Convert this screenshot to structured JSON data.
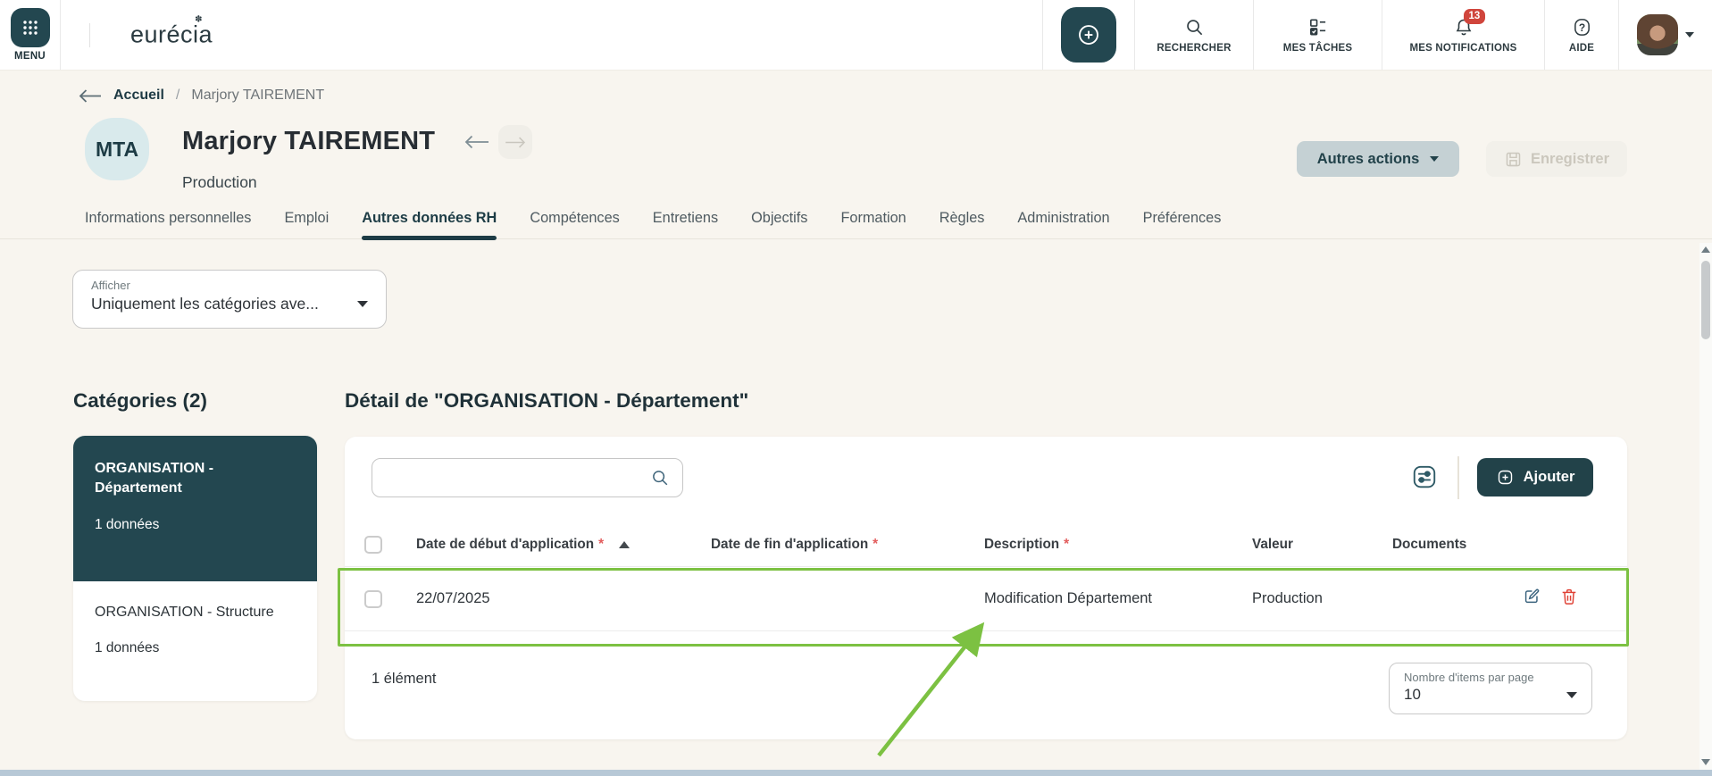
{
  "topbar": {
    "menu_label": "MENU",
    "logo_text": "eurécia",
    "nav": [
      {
        "label": "RECHERCHER"
      },
      {
        "label": "MES TÂCHES"
      },
      {
        "label": "MES NOTIFICATIONS",
        "badge": "13"
      },
      {
        "label": "AIDE"
      }
    ]
  },
  "breadcrumb": {
    "home": "Accueil",
    "separator": "/",
    "current": "Marjory TAIREMENT"
  },
  "profile": {
    "initials": "MTA",
    "name": "Marjory TAIREMENT",
    "department": "Production",
    "other_actions_label": "Autres actions",
    "save_label": "Enregistrer"
  },
  "tabs": [
    {
      "label": "Informations personnelles"
    },
    {
      "label": "Emploi"
    },
    {
      "label": "Autres données RH",
      "active": true
    },
    {
      "label": "Compétences"
    },
    {
      "label": "Entretiens"
    },
    {
      "label": "Objectifs"
    },
    {
      "label": "Formation"
    },
    {
      "label": "Règles"
    },
    {
      "label": "Administration"
    },
    {
      "label": "Préférences"
    }
  ],
  "display_filter": {
    "label": "Afficher",
    "value": "Uniquement les catégories ave..."
  },
  "categories": {
    "title": "Catégories (2)",
    "items": [
      {
        "name": "ORGANISATION - Département",
        "count": "1 données",
        "selected": true
      },
      {
        "name": "ORGANISATION - Structure",
        "count": "1 données",
        "selected": false
      }
    ]
  },
  "detail": {
    "title": "Détail de \"ORGANISATION - Département\"",
    "add_label": "Ajouter",
    "required_mark": "*",
    "columns": [
      {
        "label": "Date de début d'application",
        "required": true,
        "sorted": "asc"
      },
      {
        "label": "Date de fin d'application",
        "required": true
      },
      {
        "label": "Description",
        "required": true
      },
      {
        "label": "Valeur"
      },
      {
        "label": "Documents"
      }
    ],
    "rows": [
      {
        "date_debut": "22/07/2025",
        "date_fin": "",
        "description": "Modification Département",
        "valeur": "Production"
      }
    ],
    "footer": {
      "count_label": "1 élément",
      "per_page_label": "Nombre d'items par page",
      "per_page_value": "10"
    }
  },
  "colors": {
    "accent_dark_teal": "#234750",
    "annotation_green": "#7cc142",
    "badge_red": "#d0453c",
    "delete_red": "#df4034",
    "background_beige": "#f8f5ef"
  }
}
